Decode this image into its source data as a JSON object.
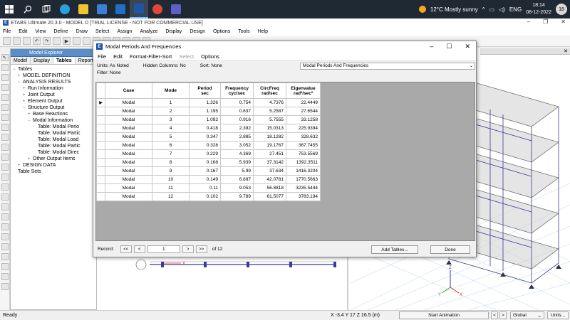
{
  "taskbar": {
    "icons": [
      "windows-icon",
      "search-icon",
      "task-view-icon",
      "edge-icon",
      "file-explorer-icon",
      "store-icon",
      "mail-icon",
      "etabs-icon",
      "chrome-icon",
      "teams-icon"
    ],
    "weather": "12°C  Mostly sunny",
    "lang": "ENG",
    "time": "18:14",
    "date": "08-12-2022",
    "badge": "18"
  },
  "app": {
    "title": "ETABS Ultimate 20.3.0 - MODEL D  [TRIAL LICENSE - NOT FOR COMMERCIAL USE]",
    "menu": [
      "File",
      "Edit",
      "View",
      "Define",
      "Draw",
      "Select",
      "Assign",
      "Analyze",
      "Display",
      "Design",
      "Options",
      "Tools",
      "Help"
    ]
  },
  "explorer": {
    "title": "Model Explorer",
    "tabs": [
      "Model",
      "Display",
      "Tables",
      "Reports"
    ],
    "tree": [
      {
        "indent": 0,
        "toggle": "−",
        "label": "Tables"
      },
      {
        "indent": 1,
        "toggle": "+",
        "label": "MODEL DEFINITION"
      },
      {
        "indent": 1,
        "toggle": "−",
        "label": "ANALYSIS RESULTS"
      },
      {
        "indent": 2,
        "toggle": "+",
        "label": "Run Information"
      },
      {
        "indent": 2,
        "toggle": "+",
        "label": "Joint Output"
      },
      {
        "indent": 2,
        "toggle": "+",
        "label": "Element Output"
      },
      {
        "indent": 2,
        "toggle": "−",
        "label": "Structure Output"
      },
      {
        "indent": 3,
        "toggle": "+",
        "label": "Base Reactions"
      },
      {
        "indent": 3,
        "toggle": "−",
        "label": "Modal Information"
      },
      {
        "indent": 4,
        "toggle": "",
        "label": "Table:  Modal Perio"
      },
      {
        "indent": 4,
        "toggle": "",
        "label": "Table:  Modal Partic"
      },
      {
        "indent": 4,
        "toggle": "",
        "label": "Table:  Modal Load"
      },
      {
        "indent": 4,
        "toggle": "",
        "label": "Table:  Modal Partic"
      },
      {
        "indent": 4,
        "toggle": "",
        "label": "Table:  Modal Direc"
      },
      {
        "indent": 3,
        "toggle": "+",
        "label": "Other Output Items"
      },
      {
        "indent": 1,
        "toggle": "+",
        "label": "DESIGN DATA"
      },
      {
        "indent": 0,
        "toggle": "",
        "label": "Table Sets"
      }
    ]
  },
  "dialog": {
    "title": "Modal Periods And Frequencies",
    "menu": [
      "File",
      "Edit",
      "Format-Filter-Sort",
      "Select",
      "Options"
    ],
    "units": "Units:  As Noted",
    "hidden": "Hidden Columns:  No",
    "sort": "Sort:  None",
    "filter": "Filter:  None",
    "table_select": "Modal Periods And Frequencies",
    "columns": [
      {
        "line1": "Case",
        "line2": ""
      },
      {
        "line1": "Mode",
        "line2": ""
      },
      {
        "line1": "Period",
        "line2": "sec"
      },
      {
        "line1": "Frequency",
        "line2": "cyc/sec"
      },
      {
        "line1": "CircFreq",
        "line2": "rad/sec"
      },
      {
        "line1": "Eigenvalue",
        "line2": "rad²/sec²"
      }
    ],
    "rows": [
      [
        "Modal",
        "1",
        "1.326",
        "0.754",
        "4.7376",
        "22.4449"
      ],
      [
        "Modal",
        "2",
        "1.195",
        "0.837",
        "5.2587",
        "27.6544"
      ],
      [
        "Modal",
        "3",
        "1.092",
        "0.916",
        "5.7555",
        "33.1258"
      ],
      [
        "Modal",
        "4",
        "0.418",
        "2.392",
        "15.0313",
        "225.9394"
      ],
      [
        "Modal",
        "5",
        "0.347",
        "2.885",
        "18.1282",
        "328.632"
      ],
      [
        "Modal",
        "6",
        "0.328",
        "3.052",
        "19.1767",
        "367.7455"
      ],
      [
        "Modal",
        "7",
        "0.229",
        "4.369",
        "27.451",
        "753.5569"
      ],
      [
        "Modal",
        "8",
        "0.168",
        "5.939",
        "37.3142",
        "1392.3511"
      ],
      [
        "Modal",
        "9",
        "0.167",
        "5.99",
        "37.634",
        "1416.3204"
      ],
      [
        "Modal",
        "10",
        "0.149",
        "6.697",
        "42.0781",
        "1770.5663"
      ],
      [
        "Modal",
        "11",
        "0.11",
        "9.053",
        "56.8818",
        "3235.5444"
      ],
      [
        "Modal",
        "12",
        "0.102",
        "9.789",
        "61.5077",
        "3783.194"
      ]
    ],
    "record_label": "Record:",
    "record_value": "1",
    "record_of": "of 12",
    "add_tables": "Add Tables...",
    "done": "Done"
  },
  "status": {
    "ready": "Ready",
    "coords": "X -3.4  Y 17  Z 16.5 (m)",
    "start_animation": "Start Animation",
    "coord_system": "Global",
    "units": "Units..."
  },
  "colors": {
    "taskbar": "#1f2933",
    "explorer_title": "#5a8ec9",
    "frame": "#3a3a9a",
    "grid_bg": "#a9a9a9"
  }
}
